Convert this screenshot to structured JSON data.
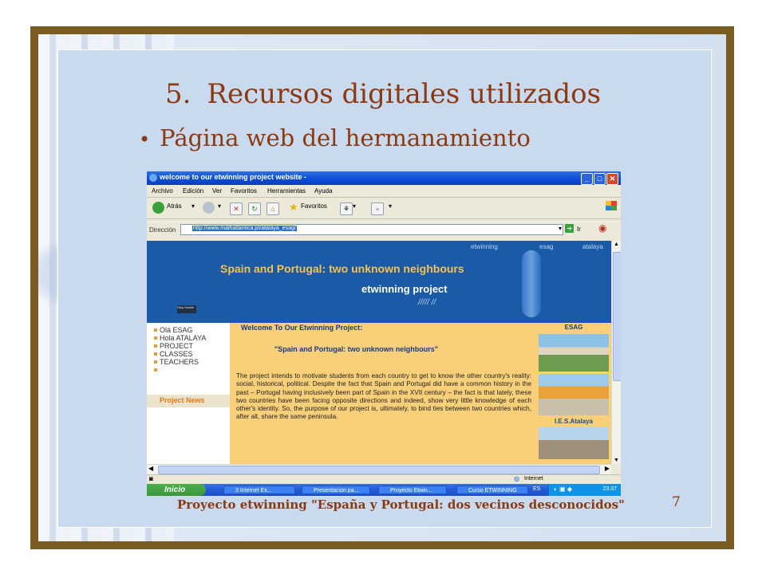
{
  "slide": {
    "title_number": "5.",
    "title": "Recursos digitales utilizados",
    "bullet": "Página web del hermanamiento",
    "footer": "Proyecto etwinning \"España y Portugal: dos vecinos desconocidos\"",
    "page_number": "7"
  },
  "browser": {
    "window_title": "welcome to our etwinning project website -",
    "menu": [
      "Archivo",
      "Edición",
      "Ver",
      "Favoritos",
      "Herramientas",
      "Ayuda"
    ],
    "toolbar": {
      "back": "Atrás",
      "favorites": "Favoritos"
    },
    "address_label": "Dirección",
    "url": "http://www.malhatlantica.pt/atalaya_esag/",
    "go_label": "Ir",
    "status_zone": "Internet"
  },
  "site": {
    "top_links": [
      "etwinning",
      "esag",
      "atalaya"
    ],
    "banner_title": "Spain and Portugal: two unknown neighbours",
    "banner_subtitle": "etwinning project",
    "logo_text": "Step Mobile",
    "nav": [
      "Olá ESAG",
      "Hola ATALAYA",
      "PROJECT",
      "CLASSES",
      "TEACHERS",
      ""
    ],
    "project_news": "Project News",
    "welcome_heading": "Welcome To Our Etwinning Project:",
    "quote_heading": "\"Spain and Portugal: two unknown neighbours\"",
    "body": "The project intends to motivate students from each country to get to know the other country's reality: social, historical, political. Despite the fact that Spain and Portugal did have a common history in the past – Portugal having inclusively been part of Spain in the XVII century – the fact is that lately, these two countries have been facing opposite directions and indeed, show very little knowledge of each other's identity. So, the purpose of our project is, ultimately, to bind ties between two countries which, after all, share the same peninsula.",
    "right_label_1": "ESAG",
    "right_label_2": "I.E.S.Atalaya"
  },
  "taskbar": {
    "start": "Inicio",
    "tasks": [
      "3 Internet Ex...",
      "Presentacion pa...",
      "Proyecto Etwin...",
      "Curso ETWINNING"
    ],
    "lang": "ES",
    "clock": "23:37"
  }
}
